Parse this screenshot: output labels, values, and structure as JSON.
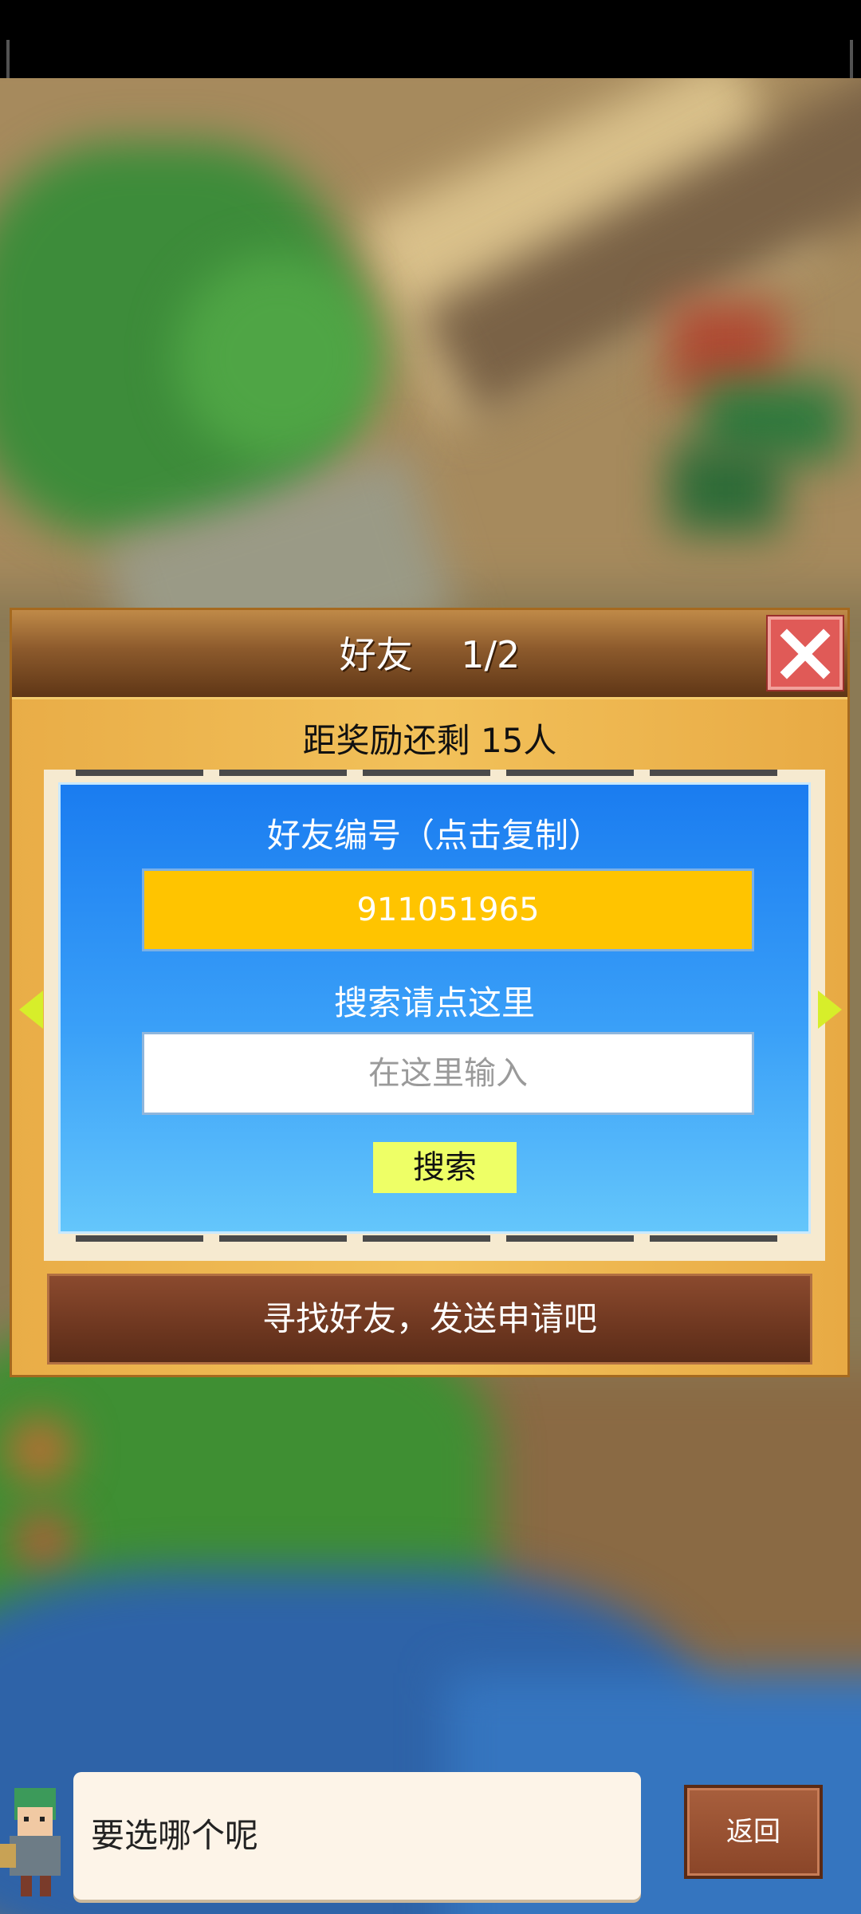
{
  "dialog": {
    "title": "好友　 1/2",
    "reward_text": "距奖励还剩 15人",
    "friend_id_label": "好友编号（点击复制）",
    "friend_id_value": "911051965",
    "search_label": "搜索请点这里",
    "search_placeholder": "在这里输入",
    "search_button": "搜索",
    "find_friends_button": "寻找好友，发送申请吧"
  },
  "bottom": {
    "speech_text": "要选哪个呢",
    "back_button": "返回"
  },
  "icons": {
    "close": "close-icon",
    "prev": "arrow-left-icon",
    "next": "arrow-right-icon",
    "avatar": "character-avatar"
  },
  "colors": {
    "panel_blue": "#1a7cf0",
    "id_yellow": "#ffc400",
    "search_button": "#eeff66",
    "close_red": "#e05a57",
    "dialog_wood": "#f2c15a"
  }
}
